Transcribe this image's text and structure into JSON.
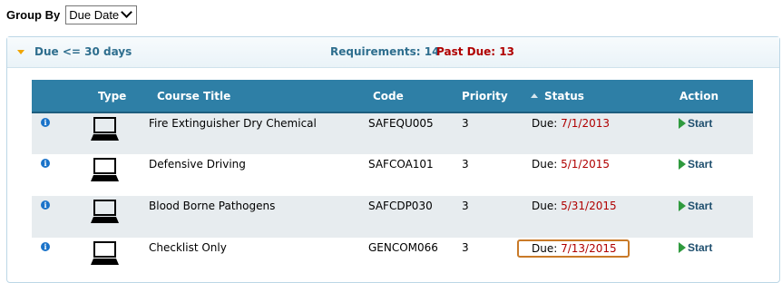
{
  "group_by": {
    "label": "Group By",
    "selected": "Due Date"
  },
  "group": {
    "title": "Due <= 30 days",
    "requirements_label": "Requirements: 14",
    "past_due_label": "Past Due: 13"
  },
  "table": {
    "headers": {
      "type": "Type",
      "course_title": "Course Title",
      "code": "Code",
      "priority": "Priority",
      "status": "Status",
      "action": "Action"
    },
    "rows": [
      {
        "title": "Fire Extinguisher Dry Chemical",
        "code": "SAFEQU005",
        "priority": "3",
        "due_prefix": "Due:",
        "due_date": "7/1/2013",
        "action": "Start"
      },
      {
        "title": "Defensive Driving",
        "code": "SAFCOA101",
        "priority": "3",
        "due_prefix": "Due:",
        "due_date": "5/1/2015",
        "action": "Start"
      },
      {
        "title": "Blood Borne Pathogens",
        "code": "SAFCDP030",
        "priority": "3",
        "due_prefix": "Due:",
        "due_date": "5/31/2015",
        "action": "Start"
      },
      {
        "title": "Checklist Only",
        "code": "GENCOM066",
        "priority": "3",
        "due_prefix": "Due:",
        "due_date": "7/13/2015",
        "action": "Start"
      }
    ]
  },
  "colors": {
    "header_bg": "#2e7fa6",
    "past_due": "#b00000",
    "start_icon": "#2f9a3e",
    "highlight_border": "#c97a28"
  },
  "icons": {
    "info": "info-icon",
    "type": "computer-icon",
    "start": "play-icon",
    "sort": "sort-asc-icon"
  }
}
